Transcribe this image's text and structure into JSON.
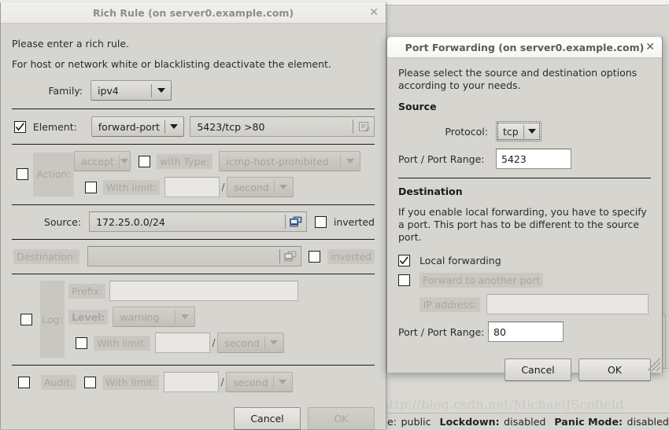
{
  "desktop": {
    "watermark": "http://blog.csdn.net/MichaelJScofield"
  },
  "statusbar": {
    "zone_value": "public",
    "lockdown_label": "Lockdown:",
    "lockdown_value": "disabled",
    "panic_label": "Panic Mode:",
    "panic_value": "disabled",
    "prefix_fragment": "e:"
  },
  "rich_rule": {
    "title": "Rich Rule (on server0.example.com)",
    "close_icon": "close-icon",
    "intro_line1": "Please enter a rich rule.",
    "intro_line2": "For host or network white or blacklisting deactivate the element.",
    "family": {
      "label": "Family:",
      "value": "ipv4"
    },
    "element": {
      "checked": true,
      "label": "Element:",
      "type_value": "forward-port",
      "entry_value": "5423/tcp >80",
      "entry_icon": "edit-dialog-icon"
    },
    "action": {
      "label": "Action:",
      "checked": false,
      "type_value": "accept",
      "with_type_label": "with Type:",
      "with_type_checked": false,
      "icmp_type_value": "icmp-host-prohibited",
      "with_limit_label": "With limit:",
      "with_limit_checked": false,
      "limit_value": "",
      "limit_unit": "second",
      "separator": "/"
    },
    "source": {
      "label": "Source:",
      "value": "172.25.0.0/24",
      "icon": "computer-icon",
      "inverted_label": "inverted",
      "inverted_checked": false
    },
    "destination": {
      "label": "Destination:",
      "value": "",
      "icon": "computer-icon",
      "inverted_label": "inverted",
      "inverted_checked": false
    },
    "log": {
      "label": "Log:",
      "checked": false,
      "prefix_label": "Prefix:",
      "prefix_value": "",
      "level_label": "Level:",
      "level_value": "warning",
      "with_limit_label": "With limit:",
      "with_limit_checked": false,
      "limit_value": "",
      "limit_unit": "second",
      "separator": "/"
    },
    "audit": {
      "label": "Audit:",
      "checked": false,
      "with_limit_label": "With limit:",
      "with_limit_checked": false,
      "limit_value": "",
      "limit_unit": "second",
      "separator": "/"
    },
    "buttons": {
      "cancel": "Cancel",
      "ok": "OK",
      "ok_enabled": false
    }
  },
  "port_forwarding": {
    "title": "Port Forwarding (on server0.example.com)",
    "close_icon": "close-icon",
    "intro": "Please select the source and destination options according to your needs.",
    "source_heading": "Source",
    "protocol": {
      "label": "Protocol:",
      "value": "tcp"
    },
    "source_port": {
      "label": "Port / Port Range:",
      "value": "5423"
    },
    "destination_heading": "Destination",
    "destination_note": "If you enable local forwarding, you have to specify a port. This port has to be different to the source port.",
    "local_forwarding": {
      "label": "Local forwarding",
      "checked": true
    },
    "forward_another": {
      "label": "Forward to another port",
      "checked": false
    },
    "ip_address": {
      "label": "IP address:",
      "value": ""
    },
    "dest_port": {
      "label": "Port / Port Range:",
      "value": "80"
    },
    "buttons": {
      "cancel": "Cancel",
      "ok": "OK"
    }
  }
}
